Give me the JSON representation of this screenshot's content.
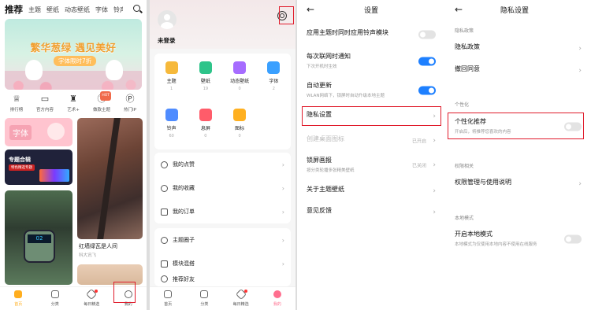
{
  "screen1": {
    "tabs": [
      "推荐",
      "主题",
      "壁纸",
      "动态壁纸",
      "字体",
      "铃声"
    ],
    "banner": {
      "title": "繁华葱绿 遇见美好",
      "subtitle": "字体限时7折"
    },
    "categories": [
      {
        "label": "排行榜",
        "icon": "ranking-icon"
      },
      {
        "label": "官方内容",
        "icon": "official-content-icon"
      },
      {
        "label": "艺术+",
        "icon": "art-icon"
      },
      {
        "label": "做款主题",
        "icon": "make-theme-icon",
        "badge": "HOT"
      },
      {
        "label": "热门IP",
        "icon": "popular-ip-icon"
      }
    ],
    "cards": {
      "font_label": "字体",
      "topic_title": "专题合辑",
      "topic_sub": "特色精选专题",
      "city_title": "红墙绿瓦是人间",
      "city_author": "科大讯飞"
    },
    "bottom_nav": [
      {
        "label": "首页",
        "active": true
      },
      {
        "label": "分类",
        "active": false
      },
      {
        "label": "每日精选",
        "active": false,
        "dot": true
      },
      {
        "label": "我的",
        "active": false
      }
    ],
    "colors": {
      "accent": "#ffae1f",
      "highlight": "#e01b2b"
    }
  },
  "screen2": {
    "username": "未登录",
    "grid": [
      {
        "label": "主题",
        "count": "1",
        "color": "#f6b93b"
      },
      {
        "label": "壁纸",
        "count": "19",
        "color": "#2ec48a"
      },
      {
        "label": "动态壁纸",
        "count": "0",
        "color": "#a66cff"
      },
      {
        "label": "字体",
        "count": "2",
        "color": "#3aa0ff"
      },
      {
        "label": "铃声",
        "count": "60",
        "color": "#4f8cff"
      },
      {
        "label": "息屏",
        "count": "0",
        "color": "#ff5c6a"
      },
      {
        "label": "图标",
        "count": "0",
        "color": "#ffb020"
      }
    ],
    "menu1": [
      "我的点赞",
      "我的收藏",
      "我的订单"
    ],
    "menu2": [
      "主题圈子",
      "模块混搭",
      "推荐好友"
    ],
    "bottom_nav": [
      {
        "label": "首页",
        "active": false
      },
      {
        "label": "分类",
        "active": false
      },
      {
        "label": "每日精选",
        "active": false,
        "dot": true
      },
      {
        "label": "我的",
        "active": true
      }
    ]
  },
  "screen3": {
    "title": "设置",
    "rows": [
      {
        "title": "应用主题时同时应用铃声模块",
        "toggle": "off"
      },
      {
        "title": "每次联网时通知",
        "sub": "下次开机时生效",
        "toggle": "on"
      },
      {
        "title": "自动更新",
        "sub": "WLAN网络下，锁屏时自动升级本地主题",
        "toggle": "on"
      },
      {
        "title": "隐私设置",
        "chevron": true
      },
      {
        "title": "创建桌面图标",
        "value": "已开启",
        "disabled": true
      },
      {
        "title": "锁屏画报",
        "sub": "按分类轮播多张精美壁纸",
        "value": "已关闭"
      },
      {
        "title": "关于主题壁纸",
        "chevron": true
      },
      {
        "title": "意见反馈",
        "chevron": true
      }
    ]
  },
  "screen4": {
    "title": "隐私设置",
    "sections": {
      "policy": "隐私政策",
      "personal": "个性化",
      "permission": "权限相关",
      "local": "本地模式"
    },
    "rows": {
      "policy": "隐私政策",
      "withdraw": "撤回同意",
      "personal_title": "个性化推荐",
      "personal_sub": "开启后，将推荐您喜欢的内容",
      "permission": "权限管理与使用说明",
      "local_title": "开启本地模式",
      "local_sub": "本地模式为仅使用本地内容不使用在线服务"
    }
  }
}
